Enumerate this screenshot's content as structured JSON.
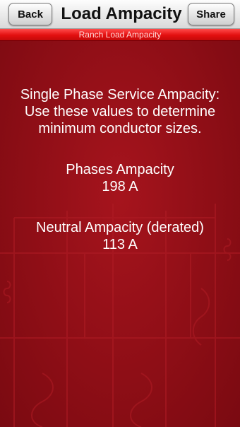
{
  "header": {
    "back_label": "Back",
    "title": "Load Ampacity",
    "share_label": "Share"
  },
  "subheader": {
    "label": "Ranch Load Ampacity"
  },
  "main": {
    "intro_line1": "Single Phase Service Ampacity:",
    "intro_line2": "Use these values to determine",
    "intro_line3": "minimum conductor sizes.",
    "phases_label": "Phases Ampacity",
    "phases_value": "198 A",
    "neutral_label": "Neutral Ampacity (derated)",
    "neutral_value": "113 A"
  },
  "colors": {
    "background": "#8f0f17",
    "accent_bar": "#e30f0f",
    "text": "#ffffff"
  }
}
